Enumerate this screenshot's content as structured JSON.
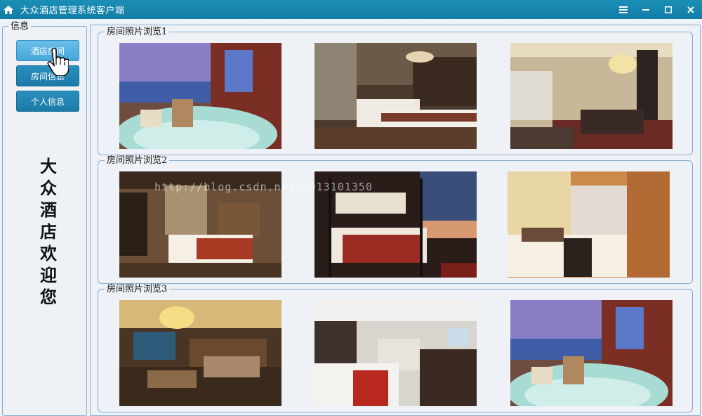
{
  "window": {
    "title": "大众酒店管理系统客户端",
    "controls": [
      "menu-icon",
      "minimize-icon",
      "maximize-icon",
      "close-icon"
    ]
  },
  "left_panel": {
    "caption": "信息",
    "buttons": [
      {
        "label": "酒店房间",
        "active": true
      },
      {
        "label": "房间信息",
        "active": false
      },
      {
        "label": "个人信息",
        "active": false
      }
    ],
    "welcome": [
      "大",
      "众",
      "酒",
      "店",
      "欢",
      "迎",
      "您"
    ]
  },
  "galleries": [
    {
      "caption": "房间照片浏览1"
    },
    {
      "caption": "房间照片浏览2"
    },
    {
      "caption": "房间照片浏览3"
    }
  ],
  "watermark": "http://blog.csdn.net/u013101350",
  "colors": {
    "titlebar": "#1584ad",
    "button": "#2386b4",
    "button_active": "#58b2e2",
    "border": "#83aed3"
  }
}
